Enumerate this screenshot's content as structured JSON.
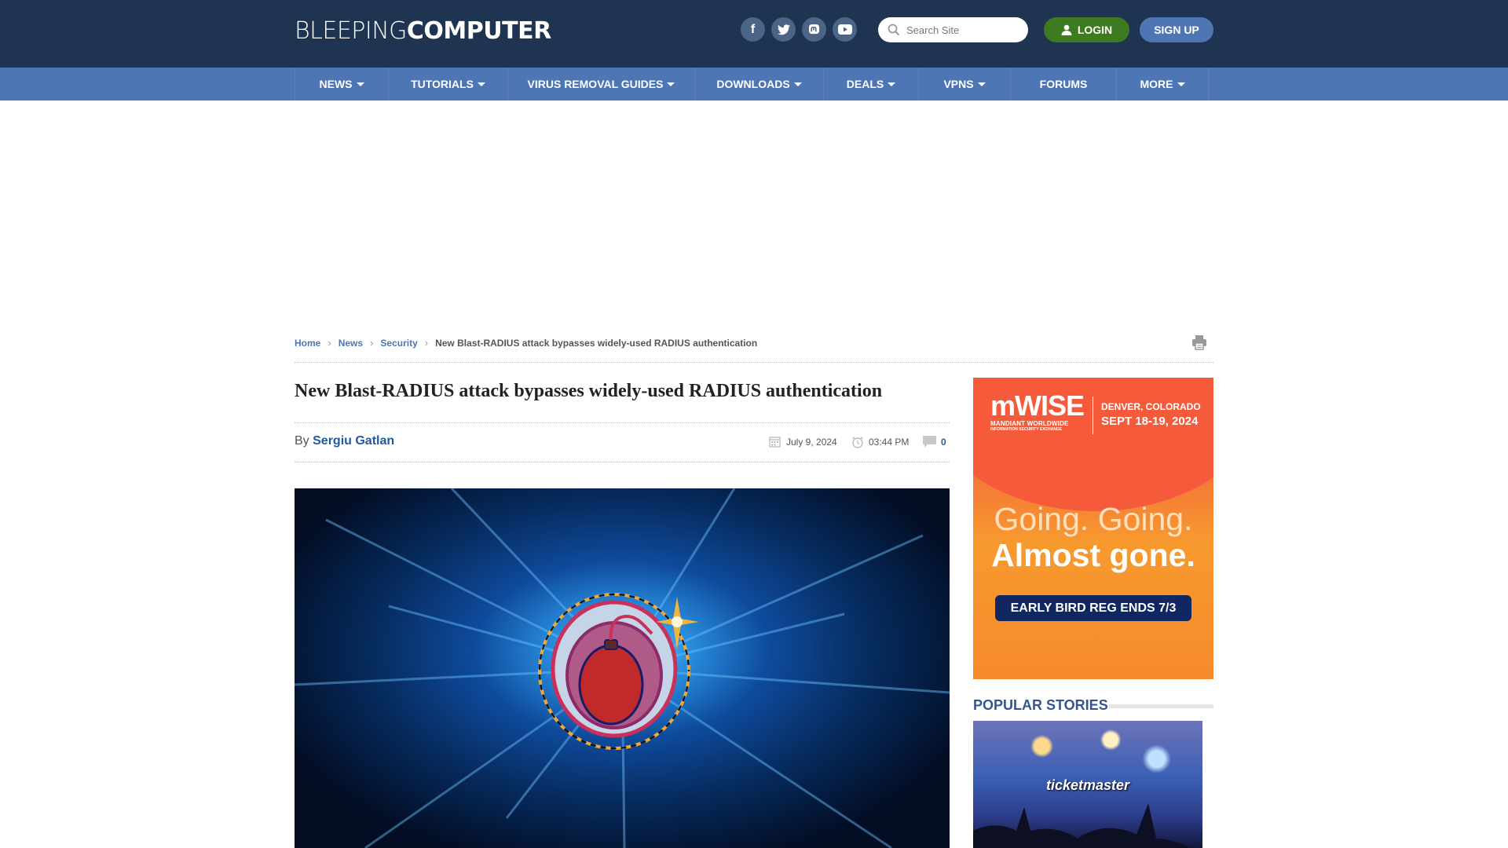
{
  "header": {
    "logo_light": "BLEEPING",
    "logo_bold": "COMPUTER",
    "social": [
      {
        "name": "facebook",
        "glyph": "f"
      },
      {
        "name": "twitter",
        "glyph": "t"
      },
      {
        "name": "mastodon",
        "glyph": "m"
      },
      {
        "name": "youtube",
        "glyph": "▶"
      }
    ],
    "search_placeholder": "Search Site",
    "login_label": "LOGIN",
    "signup_label": "SIGN UP"
  },
  "nav": {
    "items": [
      {
        "label": "NEWS",
        "dropdown": true
      },
      {
        "label": "TUTORIALS",
        "dropdown": true
      },
      {
        "label": "VIRUS REMOVAL GUIDES",
        "dropdown": true
      },
      {
        "label": "DOWNLOADS",
        "dropdown": true
      },
      {
        "label": "DEALS",
        "dropdown": true
      },
      {
        "label": "VPNS",
        "dropdown": true
      },
      {
        "label": "FORUMS",
        "dropdown": false
      },
      {
        "label": "MORE",
        "dropdown": true
      }
    ]
  },
  "breadcrumb": {
    "items": [
      "Home",
      "News",
      "Security"
    ],
    "current": "New Blast-RADIUS attack bypasses widely-used RADIUS authentication"
  },
  "article": {
    "title": "New Blast-RADIUS attack bypasses widely-used RADIUS authentication",
    "by": "By",
    "author": "Sergiu Gatlan",
    "date": "July 9, 2024",
    "time": "03:44 PM",
    "comments": "0"
  },
  "ad": {
    "brand": "mWISE",
    "sub1": "MANDIANT WORLDWIDE",
    "sub2": "INFORMATION SECURITY EXCHANGE",
    "location": "DENVER, COLORADO",
    "dates": "SEPT 18-19, 2024",
    "headline1": "Going. Going.",
    "headline2": "Almost gone.",
    "cta": "EARLY BIRD REG ENDS 7/3"
  },
  "sidebar": {
    "popular_title": "POPULAR STORIES",
    "story_image_text": "ticketmaster"
  },
  "colors": {
    "header_bg": "#1e3450",
    "nav_bg": "#4f76b4",
    "login_green": "#3e7a1f",
    "link_blue": "#1f5aa0"
  }
}
